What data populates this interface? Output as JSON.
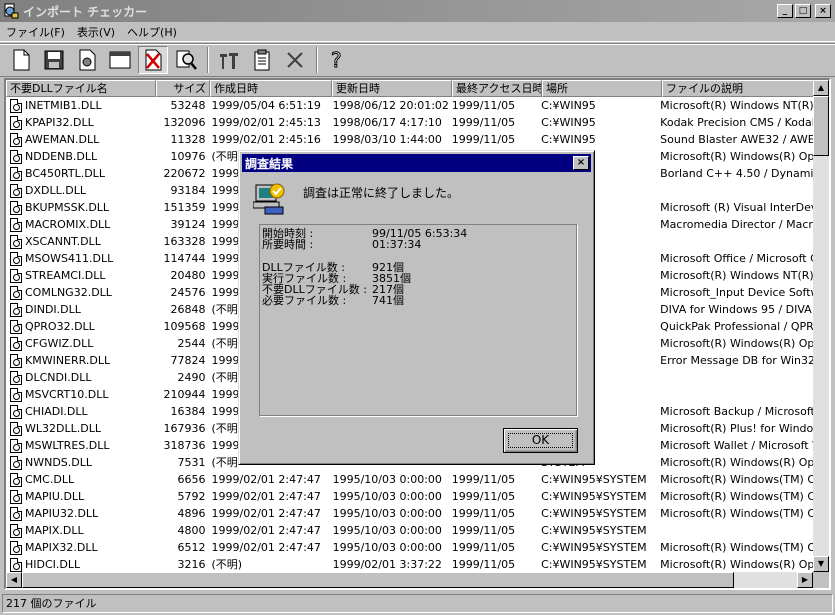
{
  "window": {
    "title": "インポート チェッカー"
  },
  "menu": [
    "ファイル(F)",
    "表示(V)",
    "ヘルプ(H)"
  ],
  "toolbar": [
    "new-icon",
    "save-icon",
    "check-icon",
    "window-icon",
    "unused-dll-icon",
    "search-icon",
    "tool-icon",
    "properties-icon",
    "delete-icon",
    "help-icon"
  ],
  "columns": [
    {
      "label": "不要DLLファイル名",
      "align": "left"
    },
    {
      "label": "サイズ",
      "align": "right"
    },
    {
      "label": "作成日時",
      "align": "left"
    },
    {
      "label": "更新日時",
      "align": "left"
    },
    {
      "label": "最終アクセス日時",
      "align": "left"
    },
    {
      "label": "場所",
      "align": "left"
    },
    {
      "label": "ファイルの説明",
      "align": "left"
    }
  ],
  "rows": [
    [
      "INETMIB1.DLL",
      "53248",
      "1999/05/04 6:51:19",
      "1998/06/12 20:01:02",
      "1999/11/05",
      "C:¥WIN95",
      "Microsoft(R) Windows NT(R)"
    ],
    [
      "KPAPI32.DLL",
      "132096",
      "1999/02/01 2:45:13",
      "1998/06/17 4:17:10",
      "1999/11/05",
      "C:¥WIN95",
      "Kodak Precision CMS / Kodak"
    ],
    [
      "AWEMAN.DLL",
      "11328",
      "1999/02/01 2:45:16",
      "1998/03/10 1:44:00",
      "1999/11/05",
      "C:¥WIN95",
      "Sound Blaster AWE32 / AWE"
    ],
    [
      "NDDENB.DLL",
      "10976",
      "(不明",
      "",
      "",
      "",
      "Microsoft(R) Windows(R) Ope"
    ],
    [
      "BC450RTL.DLL",
      "220672",
      "1999/",
      "",
      "",
      "",
      "Borland C++ 4.50 / Dynamic L"
    ],
    [
      "DXDLL.DLL",
      "93184",
      "1999/",
      "",
      "",
      "",
      ""
    ],
    [
      "BKUPMSSK.DLL",
      "151359",
      "1999/",
      "",
      "",
      "",
      "Microsoft (R) Visual InterDev"
    ],
    [
      "MACROMIX.DLL",
      "39124",
      "1999/",
      "",
      "",
      "",
      "Macromedia Director / Macro"
    ],
    [
      "XSCANNT.DLL",
      "163328",
      "1999/",
      "",
      "",
      "",
      ""
    ],
    [
      "MSOWS411.DLL",
      "114744",
      "1999/",
      "",
      "",
      "",
      "Microsoft Office / Microsoft C"
    ],
    [
      "STREAMCI.DLL",
      "20480",
      "1999/",
      "",
      "",
      "SYSTEM",
      "Microsoft(R) Windows NT(R)"
    ],
    [
      "COMLNG32.DLL",
      "24576",
      "1999/",
      "",
      "",
      "SYSTEM",
      "Microsoft_Input Device Softw"
    ],
    [
      "DINDI.DLL",
      "26848",
      "(不明",
      "",
      "",
      "SYSTEM",
      "DIVA for Windows 95 / DIVA"
    ],
    [
      "QPRO32.DLL",
      "109568",
      "1999/",
      "",
      "",
      "SYSTEM",
      "QuickPak Professional / QPR"
    ],
    [
      "CFGWIZ.DLL",
      "2544",
      "(不明",
      "",
      "",
      "SYSTEM",
      "Microsoft(R) Windows(R) Ope"
    ],
    [
      "KMWINERR.DLL",
      "77824",
      "1999/",
      "",
      "",
      "SYSTEM",
      "Error Message DB for Win32 ,"
    ],
    [
      "DLCNDI.DLL",
      "2490",
      "(不明",
      "",
      "",
      "SYSTEM",
      ""
    ],
    [
      "MSVCRT10.DLL",
      "210944",
      "1999/",
      "",
      "",
      "SYSTEM",
      ""
    ],
    [
      "CHIADI.DLL",
      "16384",
      "1999/",
      "",
      "",
      "SYSTEM",
      "Microsoft Backup / Microsoft"
    ],
    [
      "WL32DLL.DLL",
      "167936",
      "(不明",
      "",
      "",
      "SYSTEM",
      "Microsoft(R) Plus! for Window"
    ],
    [
      "MSWLTRES.DLL",
      "318736",
      "1999/",
      "",
      "",
      "SYSTEM",
      "Microsoft Wallet / Microsoft V"
    ],
    [
      "NWNDS.DLL",
      "7531",
      "(不明",
      "",
      "",
      "SYSTEM",
      "Microsoft(R) Windows(R) Ope"
    ],
    [
      "CMC.DLL",
      "6656",
      "1999/02/01 2:47:47",
      "1995/10/03 0:00:00",
      "1999/11/05",
      "C:¥WIN95¥SYSTEM",
      "Microsoft(R) Windows(TM) Op"
    ],
    [
      "MAPIU.DLL",
      "5792",
      "1999/02/01 2:47:47",
      "1995/10/03 0:00:00",
      "1999/11/05",
      "C:¥WIN95¥SYSTEM",
      "Microsoft(R) Windows(TM) Op"
    ],
    [
      "MAPIU32.DLL",
      "4896",
      "1999/02/01 2:47:47",
      "1995/10/03 0:00:00",
      "1999/11/05",
      "C:¥WIN95¥SYSTEM",
      "Microsoft(R) Windows(TM) Op"
    ],
    [
      "MAPIX.DLL",
      "4800",
      "1999/02/01 2:47:47",
      "1995/10/03 0:00:00",
      "1999/11/05",
      "C:¥WIN95¥SYSTEM",
      ""
    ],
    [
      "MAPIX32.DLL",
      "6512",
      "1999/02/01 2:47:47",
      "1995/10/03 0:00:00",
      "1999/11/05",
      "C:¥WIN95¥SYSTEM",
      "Microsoft(R) Windows(TM) Op"
    ],
    [
      "HIDCI.DLL",
      "3216",
      "(不明)",
      "1999/02/01 3:37:22",
      "1999/11/05",
      "C:¥WIN95¥SYSTEM",
      "Microsoft(R) Windows(R) Ope"
    ]
  ],
  "status": {
    "text": "217 個のファイル"
  },
  "dialog": {
    "title": "調査結果",
    "message": "調査は正常に終了しました。",
    "stats": [
      {
        "label": "開始時刻 :",
        "value": "99/11/05 6:53:34"
      },
      {
        "label": "所要時間 :",
        "value": "01:37:34"
      },
      {
        "label": "",
        "value": ""
      },
      {
        "label": "DLLファイル数 :",
        "value": "921個"
      },
      {
        "label": "実行ファイル数 :",
        "value": "3851個"
      },
      {
        "label": "不要DLLファイル数 :",
        "value": "217個"
      },
      {
        "label": "必要ファイル数 :",
        "value": "741個"
      }
    ],
    "ok": "OK"
  }
}
